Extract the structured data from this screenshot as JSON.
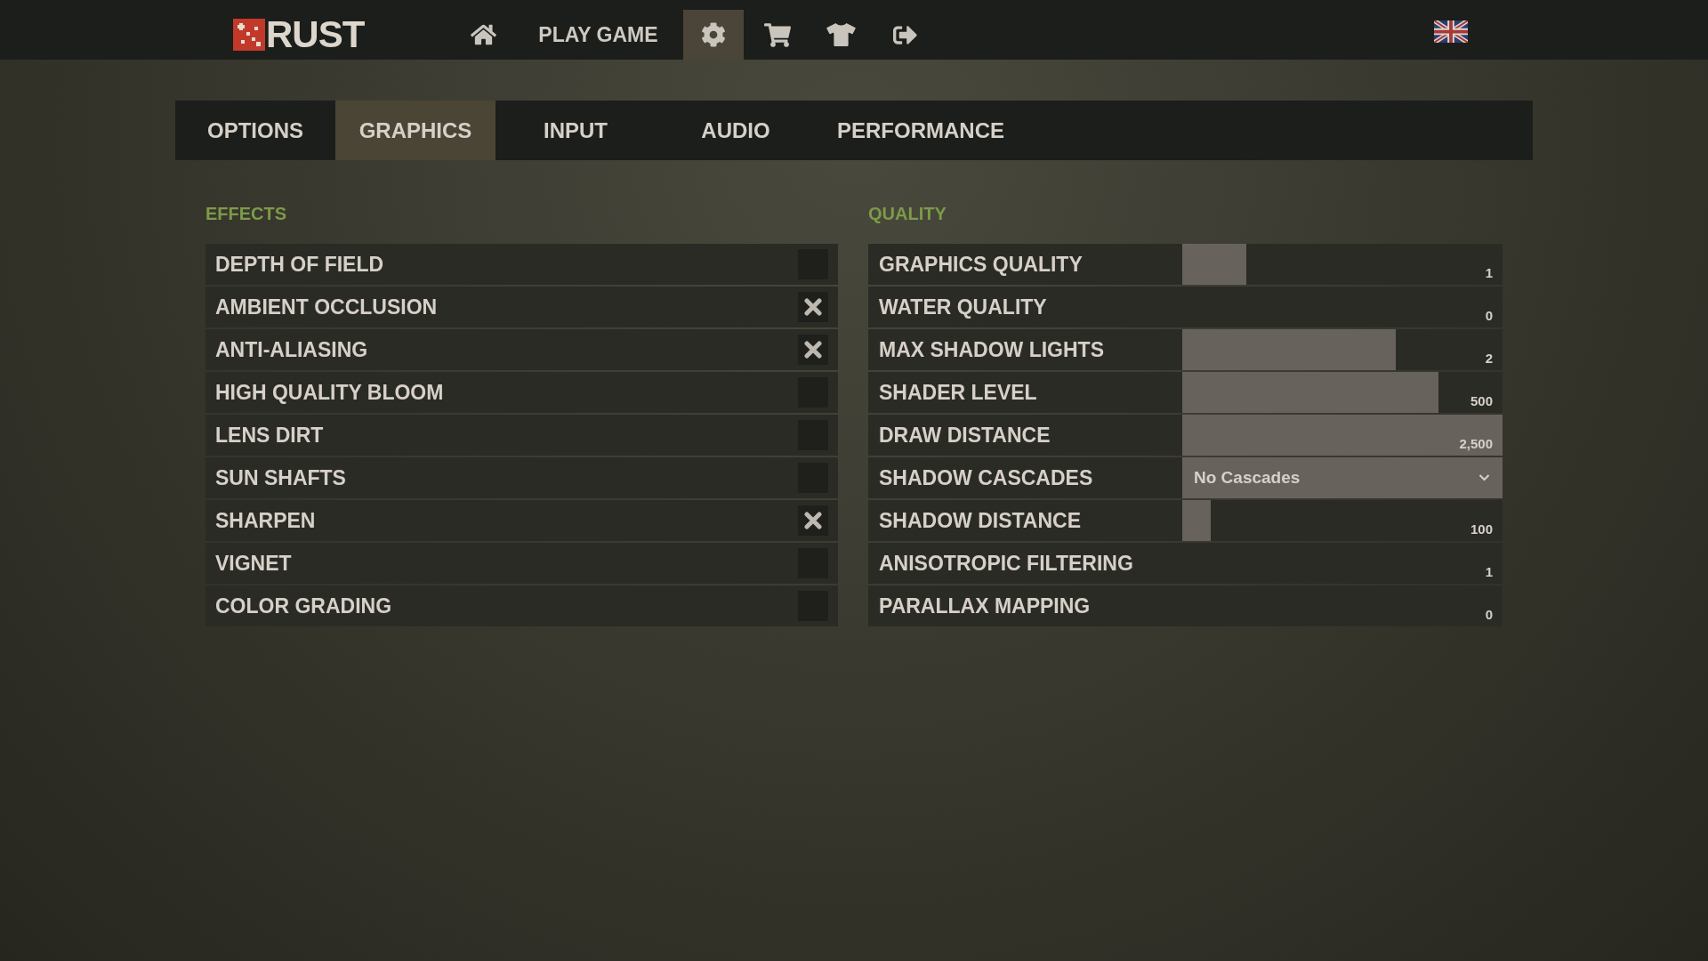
{
  "top_bar": {
    "logo_text": "RUST",
    "nav": [
      {
        "kind": "home",
        "selected": false
      },
      {
        "kind": "link",
        "label": "PLAY GAME",
        "selected": false
      },
      {
        "kind": "settings",
        "selected": true
      },
      {
        "kind": "cart",
        "selected": false
      },
      {
        "kind": "shirt",
        "selected": false
      },
      {
        "kind": "exit",
        "selected": false
      }
    ]
  },
  "tabs": [
    {
      "label": "OPTIONS",
      "selected": false
    },
    {
      "label": "GRAPHICS",
      "selected": true
    },
    {
      "label": "INPUT",
      "selected": false
    },
    {
      "label": "AUDIO",
      "selected": false
    },
    {
      "label": "PERFORMANCE",
      "selected": false
    }
  ],
  "sections": [
    {
      "title": "EFFECTS",
      "rows": [
        {
          "kind": "toggle",
          "label": "DEPTH OF FIELD",
          "checked": false
        },
        {
          "kind": "toggle",
          "label": "AMBIENT OCCLUSION",
          "checked": true
        },
        {
          "kind": "toggle",
          "label": "ANTI-ALIASING",
          "checked": true
        },
        {
          "kind": "toggle",
          "label": "HIGH QUALITY BLOOM",
          "checked": false
        },
        {
          "kind": "toggle",
          "label": "LENS DIRT",
          "checked": false
        },
        {
          "kind": "toggle",
          "label": "SUN SHAFTS",
          "checked": false
        },
        {
          "kind": "toggle",
          "label": "SHARPEN",
          "checked": true
        },
        {
          "kind": "toggle",
          "label": "VIGNET",
          "checked": false
        },
        {
          "kind": "toggle",
          "label": "COLOR GRADING",
          "checked": false
        }
      ]
    },
    {
      "title": "QUALITY",
      "rows": [
        {
          "kind": "slider",
          "label": "GRAPHICS QUALITY",
          "level": 0.2,
          "reading": "1"
        },
        {
          "kind": "slider",
          "label": "WATER QUALITY",
          "reading": "0"
        },
        {
          "kind": "slider",
          "label": "MAX SHADOW LIGHTS",
          "level": 0.667,
          "reading": "2"
        },
        {
          "kind": "slider",
          "label": "SHADER LEVEL",
          "level": 0.8,
          "reading": "500"
        },
        {
          "kind": "slider",
          "label": "DRAW DISTANCE",
          "level": 1,
          "reading": "2,500"
        },
        {
          "kind": "dropdown",
          "label": "SHADOW CASCADES",
          "value": "No Cascades"
        },
        {
          "kind": "slider",
          "label": "SHADOW DISTANCE",
          "level": 0.09,
          "reading": "100"
        },
        {
          "kind": "slider",
          "label": "ANISOTROPIC FILTERING",
          "reading": "1"
        },
        {
          "kind": "slider",
          "label": "PARALLAX MAPPING",
          "reading": "0"
        }
      ]
    }
  ]
}
